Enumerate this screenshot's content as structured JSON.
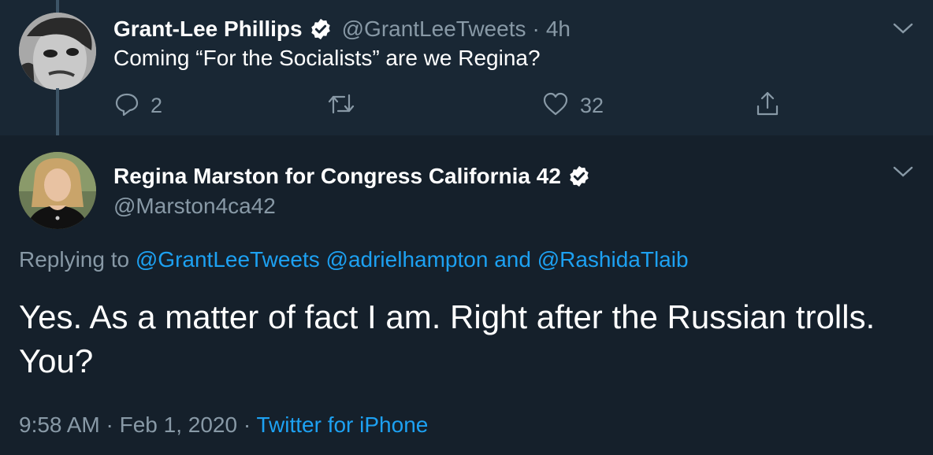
{
  "reply_tweet": {
    "display_name": "Grant-Lee Phillips",
    "handle": "@GrantLeeTweets",
    "separator": "·",
    "time": "4h",
    "text": "Coming “For the Socialists” are we Regina?",
    "reply_count": "2",
    "retweet_count": "",
    "like_count": "32",
    "icons": [
      "verified-icon",
      "chevron-down-icon",
      "reply-icon",
      "retweet-icon",
      "like-icon",
      "share-icon"
    ]
  },
  "main_tweet": {
    "display_name": "Regina Marston for Congress California 42",
    "handle": "@Marston4ca42",
    "replying_prefix": "Replying to",
    "mention_1": "@GrantLeeTweets",
    "mention_2": "@adrielhampton",
    "mention_joiner": "and",
    "mention_3": "@RashidaTlaib",
    "text": "Yes. As a matter of fact I am. Right after the Russian trolls. You?",
    "time": "9:58 AM",
    "date": "Feb 1, 2020",
    "separator": "·",
    "source": "Twitter for iPhone"
  },
  "colors": {
    "background": "#15202b",
    "thread_background": "#192734",
    "muted_text": "#8899a6",
    "link": "#1da1f2"
  }
}
